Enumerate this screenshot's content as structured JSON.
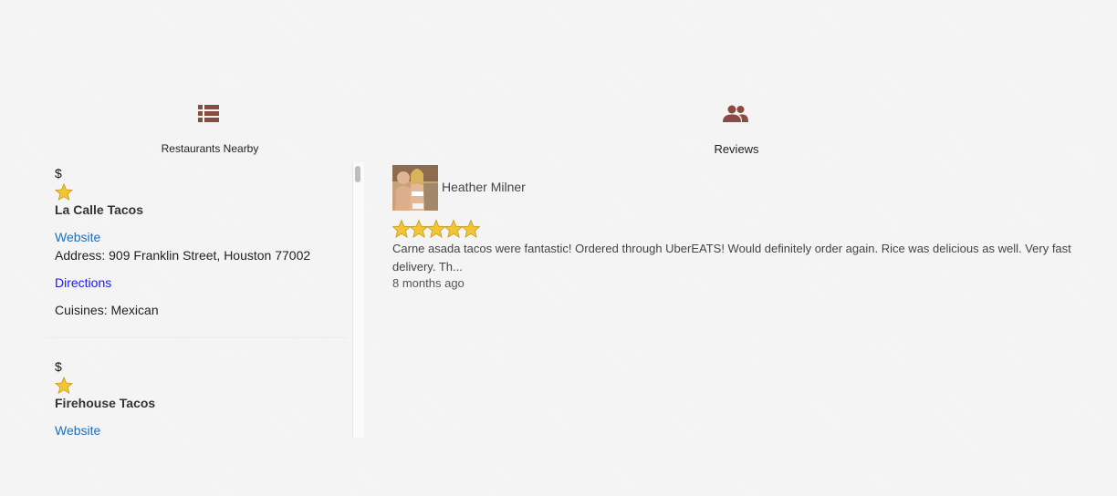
{
  "left_panel": {
    "icon": "list-icon",
    "title": "Restaurants Nearby",
    "restaurants": [
      {
        "price": "$",
        "rating": 1,
        "name": "La Calle Tacos",
        "website_label": "Website",
        "address": "Address: 909 Franklin Street, Houston 77002",
        "directions_label": "Directions",
        "cuisines": "Cuisines: Mexican"
      },
      {
        "price": "$",
        "rating": 1,
        "name": "Firehouse Tacos",
        "website_label": "Website"
      }
    ]
  },
  "right_panel": {
    "icon": "people-icon",
    "title": "Reviews",
    "reviews": [
      {
        "author": "Heather Milner",
        "rating": 5,
        "text": "Carne asada tacos were fantastic! Ordered through UberEATS! Would definitely order again. Rice was delicious as well. Very fast delivery. Th...",
        "time": "8 months ago"
      }
    ]
  },
  "colors": {
    "icon": "#8a4b40",
    "link": "#1f6fb8",
    "directions_link": "#1a1ae6",
    "star": "#f2c534"
  }
}
